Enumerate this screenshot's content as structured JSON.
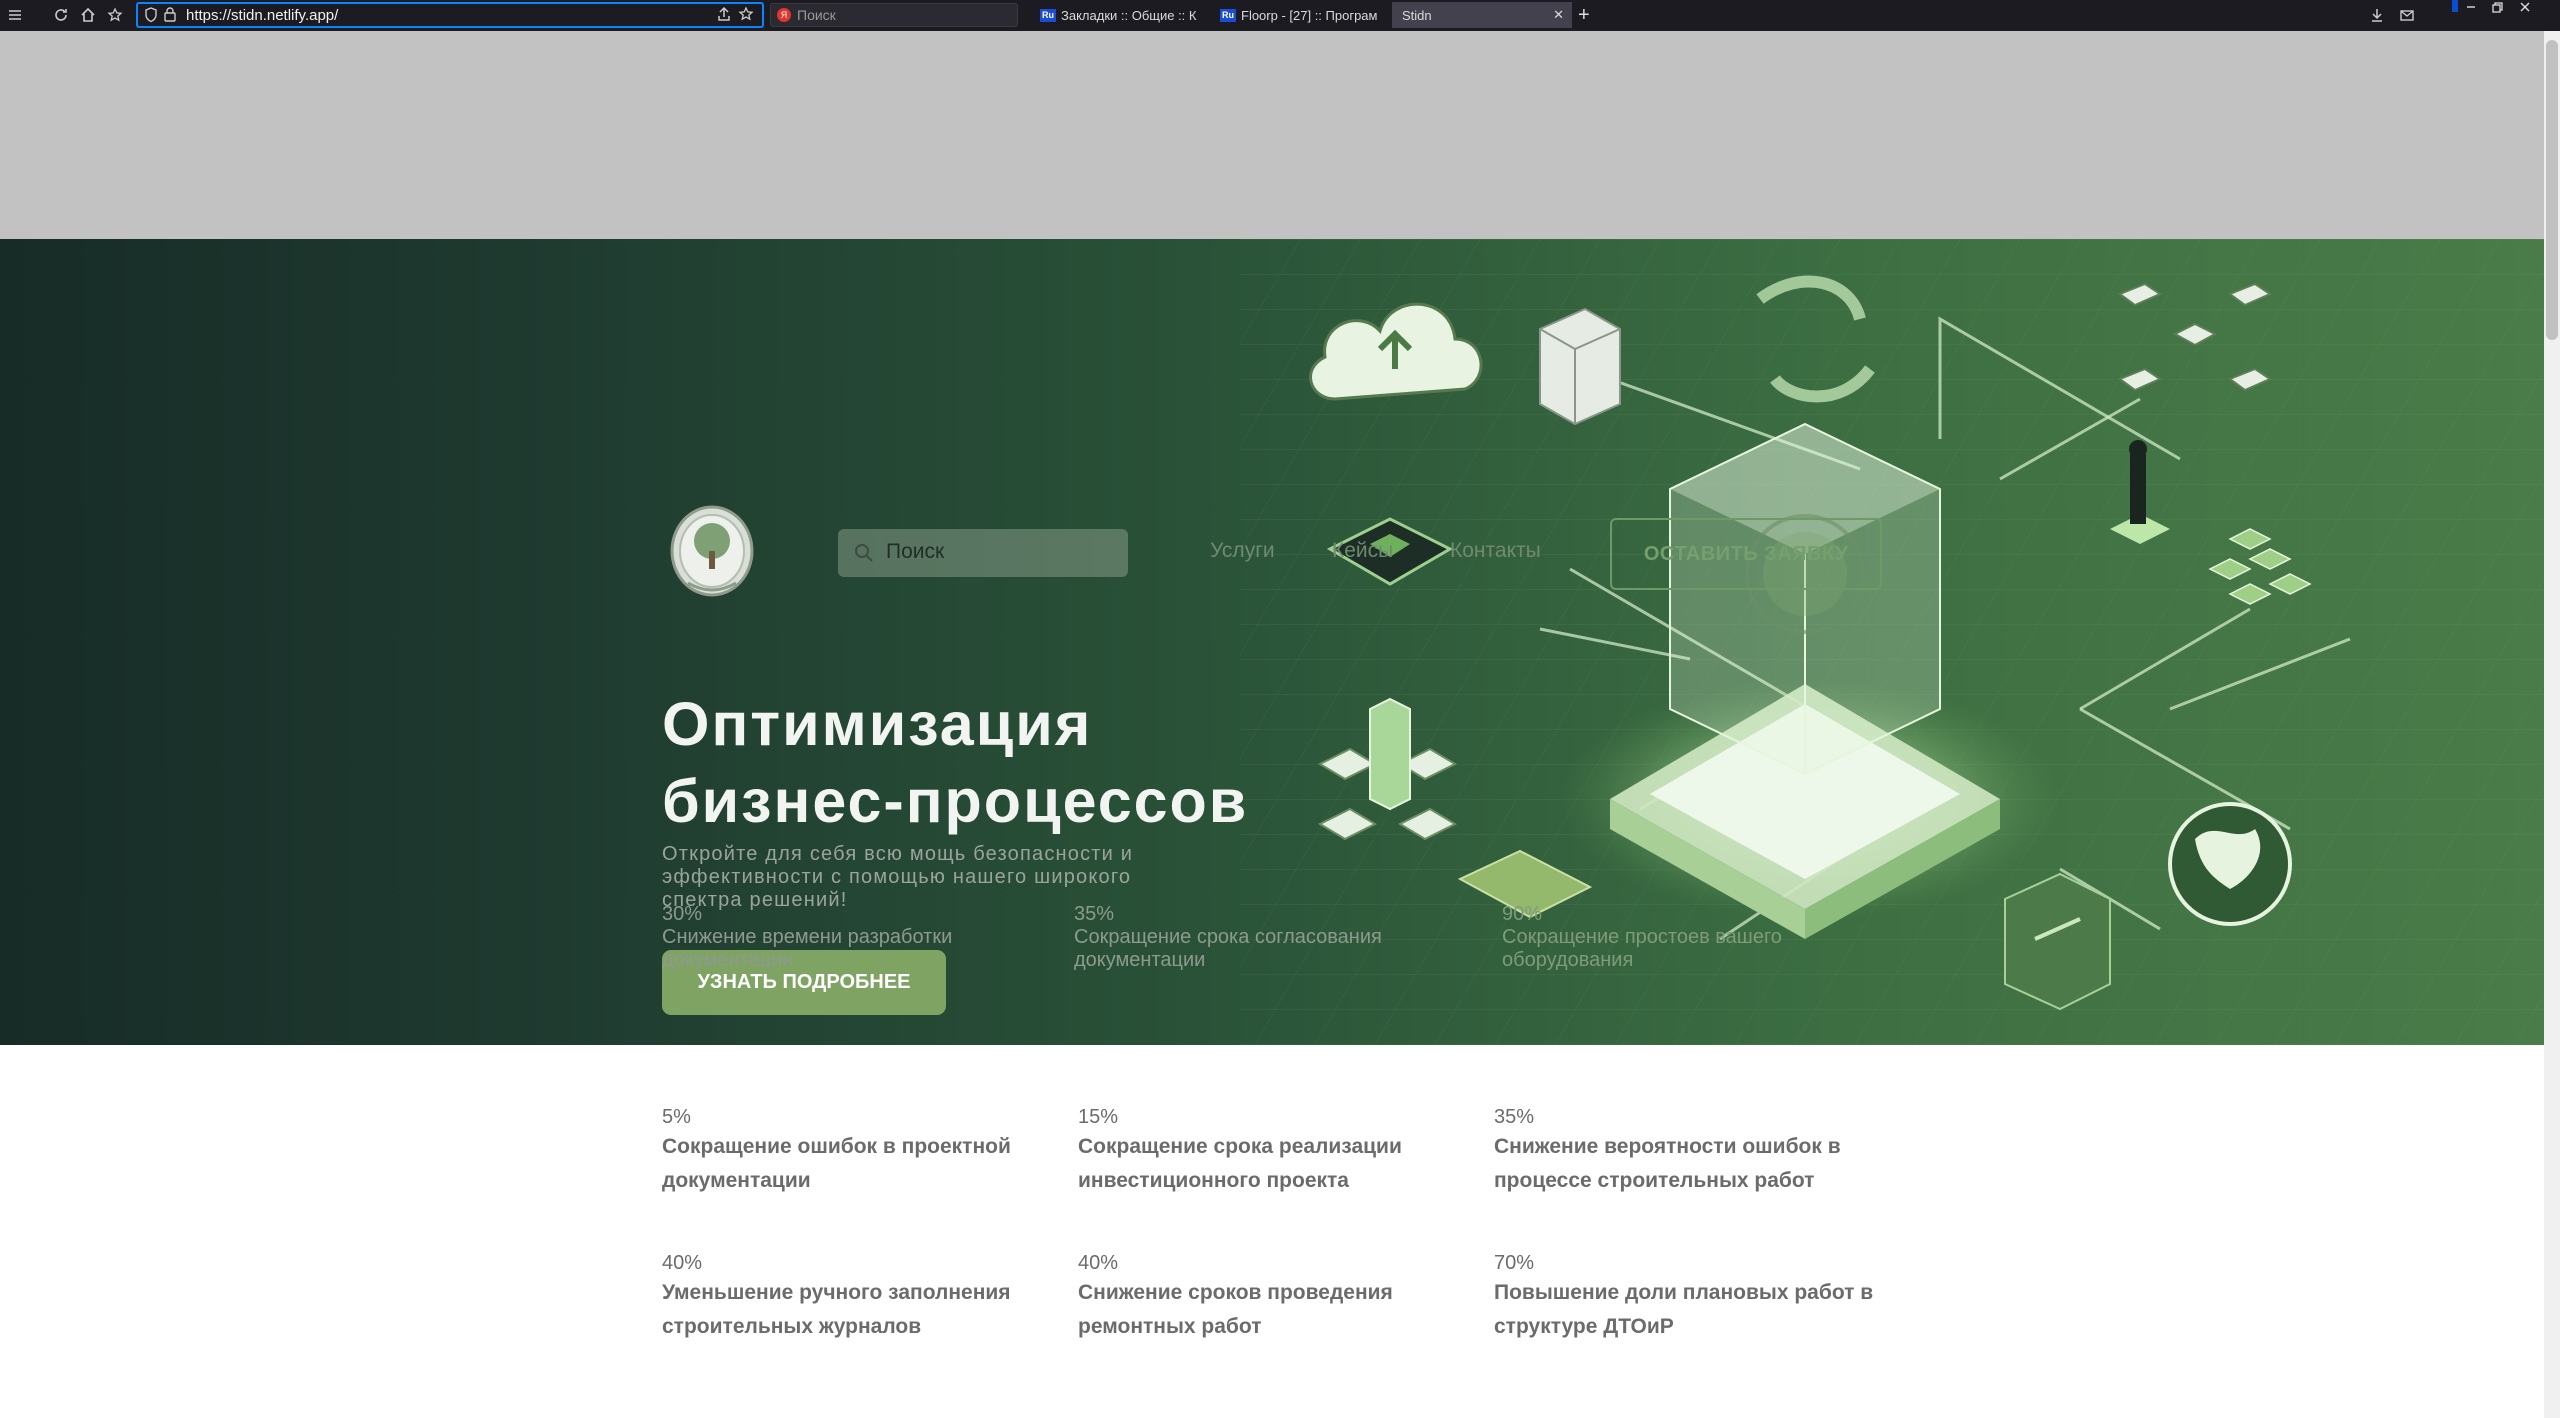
{
  "browser": {
    "url": "https://stidn.netlify.app/",
    "search_placeholder": "Поиск",
    "tabs": [
      {
        "label": "Закладки :: Общие :: К",
        "favicon": "Ru"
      },
      {
        "label": "Floorp - [27] :: Програм",
        "favicon": "Ru"
      },
      {
        "label": "Stidn",
        "favicon": ""
      }
    ],
    "new_tab_label": "+",
    "close_tab_label": "✕"
  },
  "nav": {
    "search_placeholder": "Поиск",
    "links": [
      "Услуги",
      "Кейсы",
      "Контакты"
    ],
    "cta": "ОСТАВИТЬ ЗАЯВКУ"
  },
  "hero": {
    "title_line1": "Оптимизация",
    "title_line2": "бизнес-процессов",
    "subtitle": "Откройте для себя всю мощь безопасности и эффективности с помощью нашего широкого спектра решений!",
    "button": "УЗНАТЬ ПОДРОБНЕЕ",
    "stats": [
      {
        "value": "30%",
        "label": "Снижение времени разработки документации"
      },
      {
        "value": "35%",
        "label": "Сокращение срока согласования документации"
      },
      {
        "value": "90%",
        "label": "Сокращение простоев вашего оборудования"
      }
    ]
  },
  "stats": [
    {
      "value": "5%",
      "label": "Сокращение ошибок в проектной документации"
    },
    {
      "value": "15%",
      "label": "Сокращение срока реализации инвестиционного проекта"
    },
    {
      "value": "35%",
      "label": "Снижение вероятности ошибок в процессе строительных работ"
    },
    {
      "value": "40%",
      "label": "Уменьшение ручного заполнения строительных журналов"
    },
    {
      "value": "40%",
      "label": "Снижение сроков проведения ремонтных работ"
    },
    {
      "value": "70%",
      "label": "Повышение доли плановых работ в структуре ДТОиР"
    }
  ],
  "colors": {
    "accent": "#7fa362",
    "hero_dark": "#172b27",
    "hero_light": "#4a7c49"
  }
}
